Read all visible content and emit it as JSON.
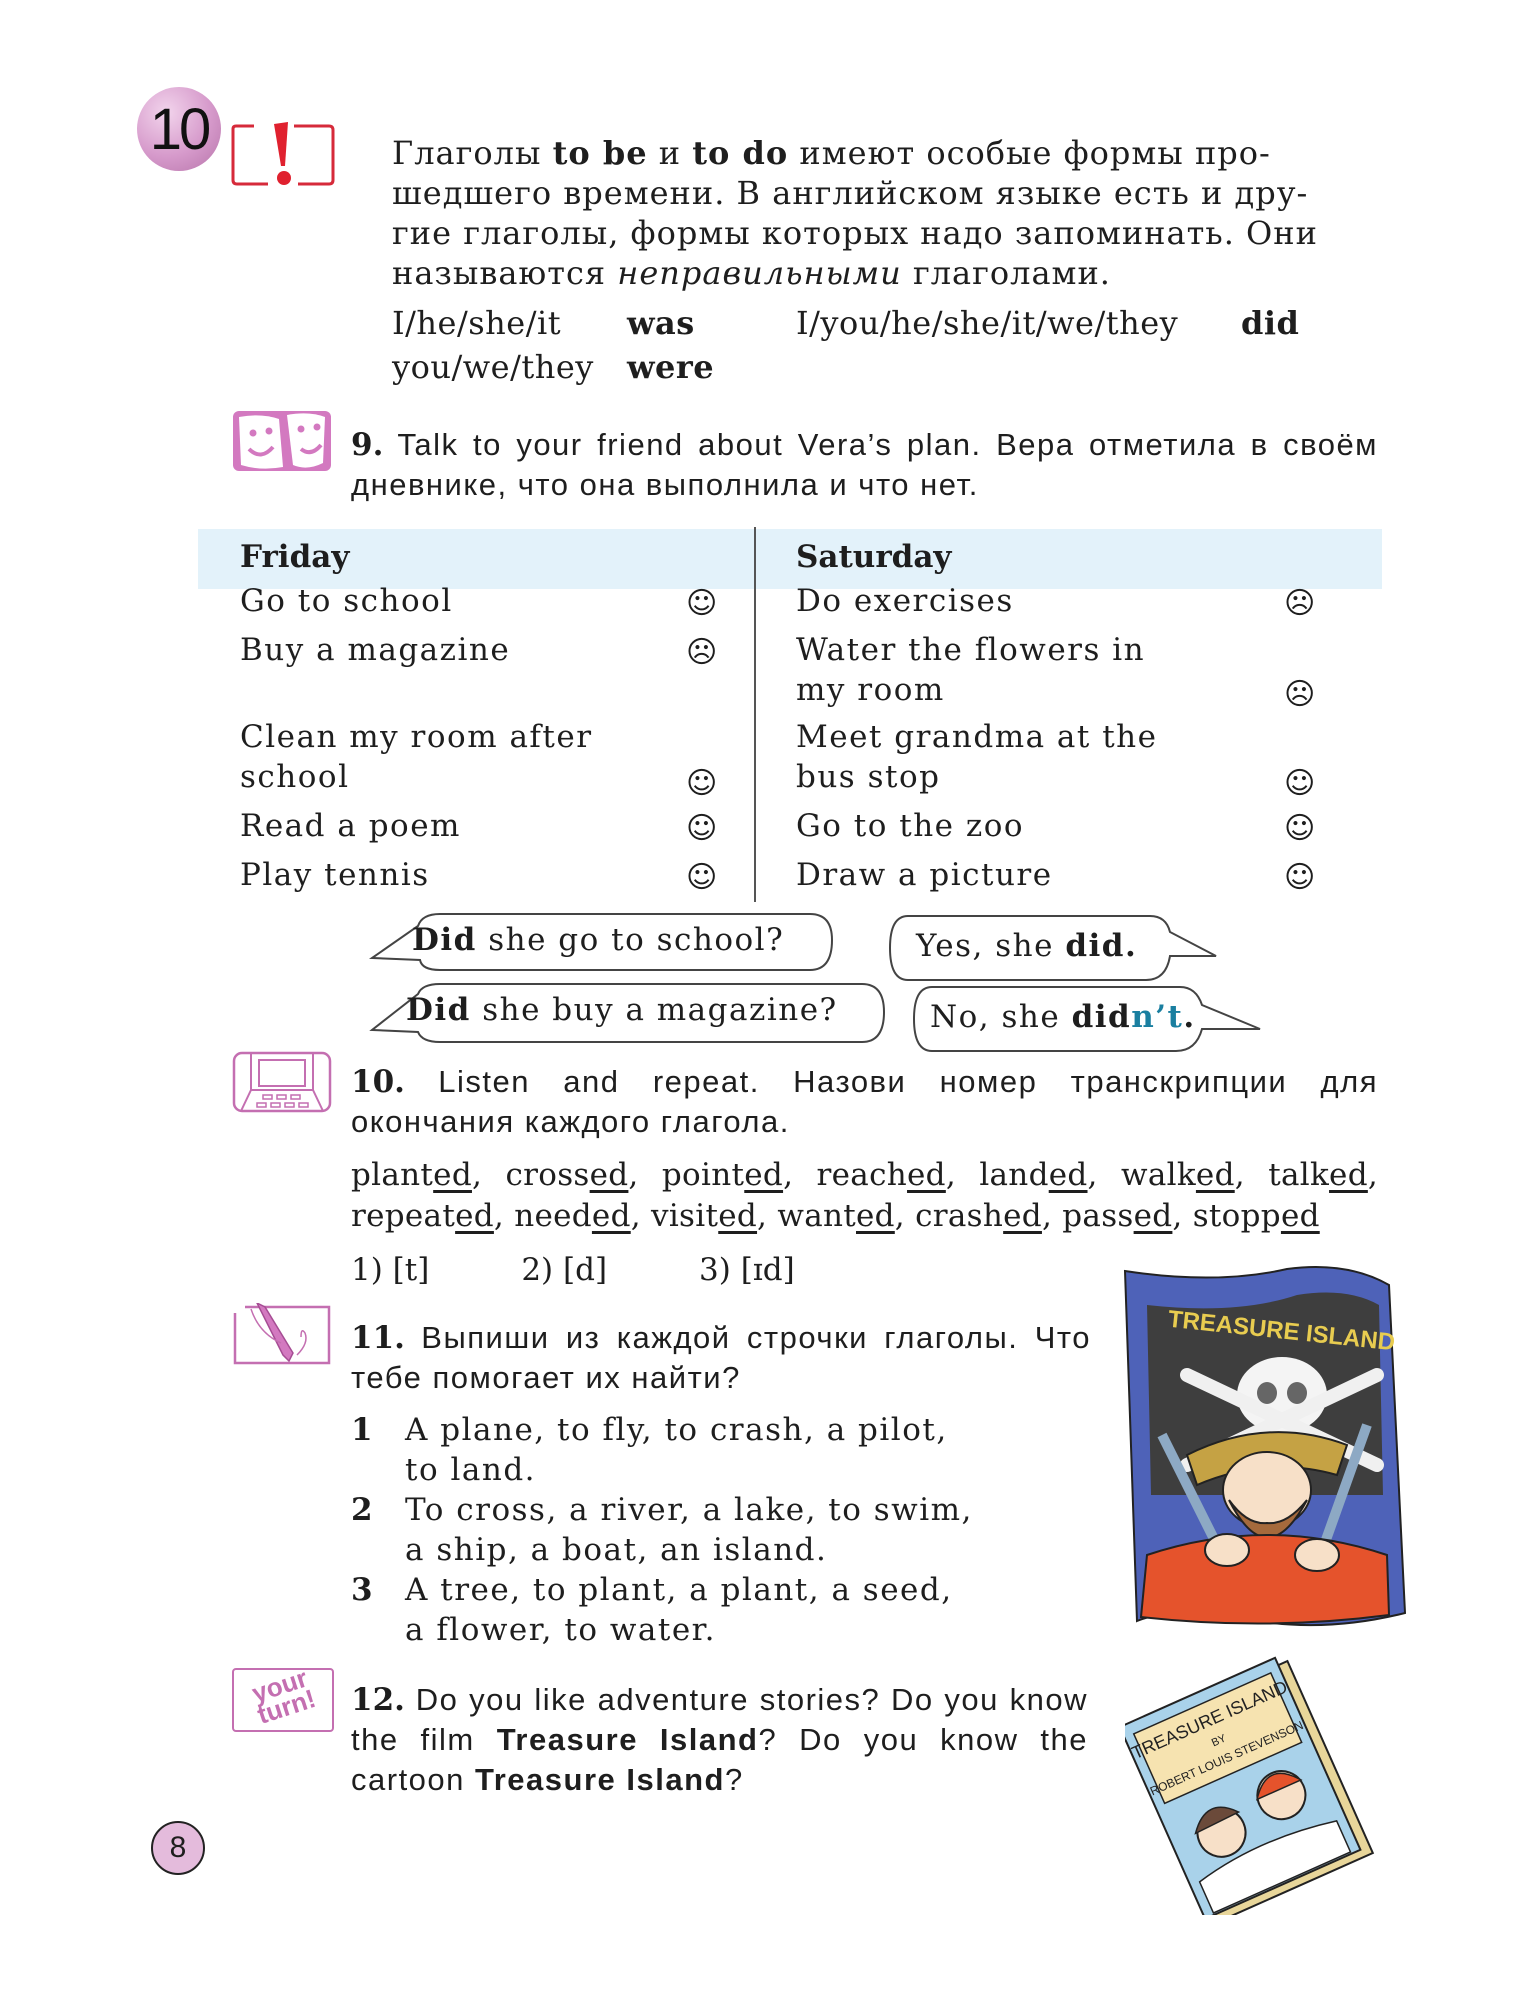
{
  "lesson": {
    "number": "10"
  },
  "note": {
    "line1_parts": [
      "Глаголы ",
      "to be",
      " и ",
      "to do",
      " имеют особые формы про-"
    ],
    "line2": "шедшего времени. В английском языке есть и дру-",
    "line3": "гие глаголы, формы которых надо запоминать. Они",
    "line4_parts": [
      "называются ",
      "неправильными",
      " глаголами."
    ],
    "forms": [
      {
        "subject": "I/he/she/it",
        "verb": "was"
      },
      {
        "subject": "you/we/they",
        "verb": "were"
      },
      {
        "subject": "I/you/he/she/it/we/they",
        "verb": "did"
      }
    ]
  },
  "task9": {
    "number": "9.",
    "text": "Talk to your friend about Vera’s plan. Вера отметила в своём дневнике, что она выполнила и что нет.",
    "icon": "theatre-masks-icon",
    "table": {
      "headers": [
        "Friday",
        "Saturday"
      ],
      "friday": [
        {
          "task": "Go to school",
          "result": "done",
          "face": "☺"
        },
        {
          "task": "Buy a magazine",
          "result": "not done",
          "face": "☹"
        },
        {
          "task": "Clean my room after school",
          "result": "done",
          "face": "☺"
        },
        {
          "task": "Read a poem",
          "result": "done",
          "face": "☺"
        },
        {
          "task": "Play tennis",
          "result": "done",
          "face": "☺"
        }
      ],
      "saturday": [
        {
          "task": "Do exercises",
          "result": "not done",
          "face": "☹"
        },
        {
          "task": "Water the flowers in my room",
          "result": "not done",
          "face": "☹"
        },
        {
          "task": "Meet grandma at the bus stop",
          "result": "done",
          "face": "☺"
        },
        {
          "task": "Go to the zoo",
          "result": "done",
          "face": "☺"
        },
        {
          "task": "Draw a picture",
          "result": "done",
          "face": "☺"
        }
      ]
    },
    "bubbles": {
      "q1_bold": "Did",
      "q1_rest": " she go to school?",
      "a1_pre": "Yes, she ",
      "a1_bold": "did.",
      "q2_bold": "Did",
      "q2_rest": " she buy a magazine?",
      "a2_pre": "No, she ",
      "a2_bold": "did",
      "a2_accent": "n’t",
      "a2_end": ".",
      "accent_color": "#1a7fa0"
    }
  },
  "task10": {
    "number": "10.",
    "text": "Listen and repeat. Назови номер транскрипции для окончания каждого глагола.",
    "icon": "laptop-icon",
    "words": [
      {
        "stem": "plant",
        "ending": "ed"
      },
      {
        "stem": "cross",
        "ending": "ed"
      },
      {
        "stem": "point",
        "ending": "ed"
      },
      {
        "stem": "reach",
        "ending": "ed"
      },
      {
        "stem": "land",
        "ending": "ed"
      },
      {
        "stem": "walk",
        "ending": "ed"
      },
      {
        "stem": "talk",
        "ending": "ed"
      },
      {
        "stem": "repeat",
        "ending": "ed"
      },
      {
        "stem": "need",
        "ending": "ed"
      },
      {
        "stem": "visit",
        "ending": "ed"
      },
      {
        "stem": "want",
        "ending": "ed"
      },
      {
        "stem": "crash",
        "ending": "ed"
      },
      {
        "stem": "pass",
        "ending": "ed"
      },
      {
        "stem": "stopp",
        "ending": "ed"
      }
    ],
    "sounds": [
      "1) [t]",
      "2) [d]",
      "3) [ɪd]"
    ]
  },
  "task11": {
    "number": "11.",
    "text": "Выпиши из каждой строчки глаголы. Что тебе помогает их найти?",
    "icon": "pen-writing-icon",
    "items": [
      {
        "n": "1",
        "line1": "A plane, to fly, to crash, a pilot,",
        "line2": "to land."
      },
      {
        "n": "2",
        "line1": "To cross, a river, a lake, to swim,",
        "line2": "a ship, a boat, an island."
      },
      {
        "n": "3",
        "line1": "A tree, to plant, a plant, a seed,",
        "line2": "a flower, to water."
      }
    ]
  },
  "task12": {
    "number": "12.",
    "icon_text": "your turn!",
    "parts": [
      "Do you like adventure stories? Do you know the film ",
      "Treasure Island",
      "? Do you know the cartoon ",
      "Treasure Island",
      "?"
    ]
  },
  "illustrations": {
    "poster_title": "TREASURE ISLAND",
    "book_title": "TREASURE ISLAND",
    "book_by": "BY",
    "book_author": "ROBERT LOUIS STEVENSON"
  },
  "page_number": "8"
}
